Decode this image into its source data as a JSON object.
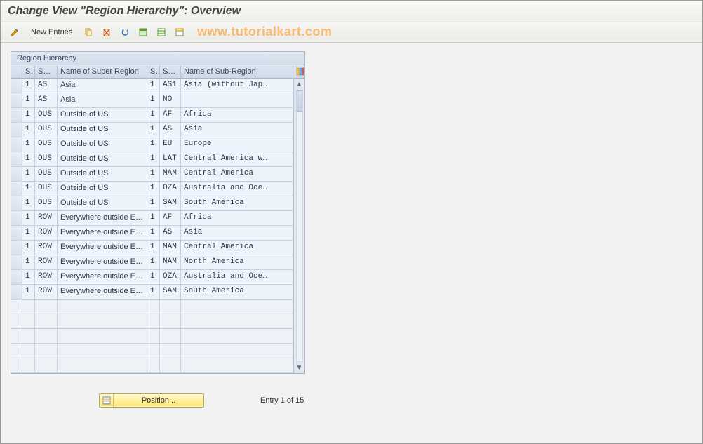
{
  "title": "Change View \"Region Hierarchy\": Overview",
  "toolbar": {
    "new_entries_label": "New Entries",
    "icons": {
      "pencil": "pencil-icon",
      "copy": "copy-icon",
      "delete": "delete-icon",
      "undo": "undo-icon",
      "select_all": "select-all-icon",
      "select_block": "select-block-icon",
      "deselect": "deselect-icon"
    }
  },
  "watermark": "www.tutorialkart.com",
  "grid": {
    "title": "Region Hierarchy",
    "columns": {
      "s1": "S..",
      "su1": "Su…",
      "name1": "Name of Super Region",
      "s2": "S..",
      "su2": "Su…",
      "name2": "Name of Sub-Region"
    },
    "rows": [
      {
        "s1": "1",
        "su1": "AS",
        "name1": "Asia",
        "s2": "1",
        "su2": "AS1",
        "name2": "Asia (without Jap…"
      },
      {
        "s1": "1",
        "su1": "AS",
        "name1": "Asia",
        "s2": "1",
        "su2": "NO",
        "name2": ""
      },
      {
        "s1": "1",
        "su1": "OUS",
        "name1": "Outside of US",
        "s2": "1",
        "su2": "AF",
        "name2": "Africa"
      },
      {
        "s1": "1",
        "su1": "OUS",
        "name1": "Outside of US",
        "s2": "1",
        "su2": "AS",
        "name2": "Asia"
      },
      {
        "s1": "1",
        "su1": "OUS",
        "name1": "Outside of US",
        "s2": "1",
        "su2": "EU",
        "name2": "Europe"
      },
      {
        "s1": "1",
        "su1": "OUS",
        "name1": "Outside of US",
        "s2": "1",
        "su2": "LAT",
        "name2": "Central America w…"
      },
      {
        "s1": "1",
        "su1": "OUS",
        "name1": "Outside of US",
        "s2": "1",
        "su2": "MAM",
        "name2": "Central America"
      },
      {
        "s1": "1",
        "su1": "OUS",
        "name1": "Outside of US",
        "s2": "1",
        "su2": "OZA",
        "name2": "Australia and Oce…"
      },
      {
        "s1": "1",
        "su1": "OUS",
        "name1": "Outside of US",
        "s2": "1",
        "su2": "SAM",
        "name2": "South America"
      },
      {
        "s1": "1",
        "su1": "ROW",
        "name1": "Everywhere outside Euro…",
        "s2": "1",
        "su2": "AF",
        "name2": "Africa"
      },
      {
        "s1": "1",
        "su1": "ROW",
        "name1": "Everywhere outside Euro…",
        "s2": "1",
        "su2": "AS",
        "name2": "Asia"
      },
      {
        "s1": "1",
        "su1": "ROW",
        "name1": "Everywhere outside Euro…",
        "s2": "1",
        "su2": "MAM",
        "name2": "Central America"
      },
      {
        "s1": "1",
        "su1": "ROW",
        "name1": "Everywhere outside Euro…",
        "s2": "1",
        "su2": "NAM",
        "name2": "North America"
      },
      {
        "s1": "1",
        "su1": "ROW",
        "name1": "Everywhere outside Euro…",
        "s2": "1",
        "su2": "OZA",
        "name2": "Australia and Oce…"
      },
      {
        "s1": "1",
        "su1": "ROW",
        "name1": "Everywhere outside Euro…",
        "s2": "1",
        "su2": "SAM",
        "name2": "South America"
      }
    ],
    "empty_rows": 5
  },
  "footer": {
    "position_label": "Position...",
    "entry_info": "Entry 1 of 15"
  }
}
